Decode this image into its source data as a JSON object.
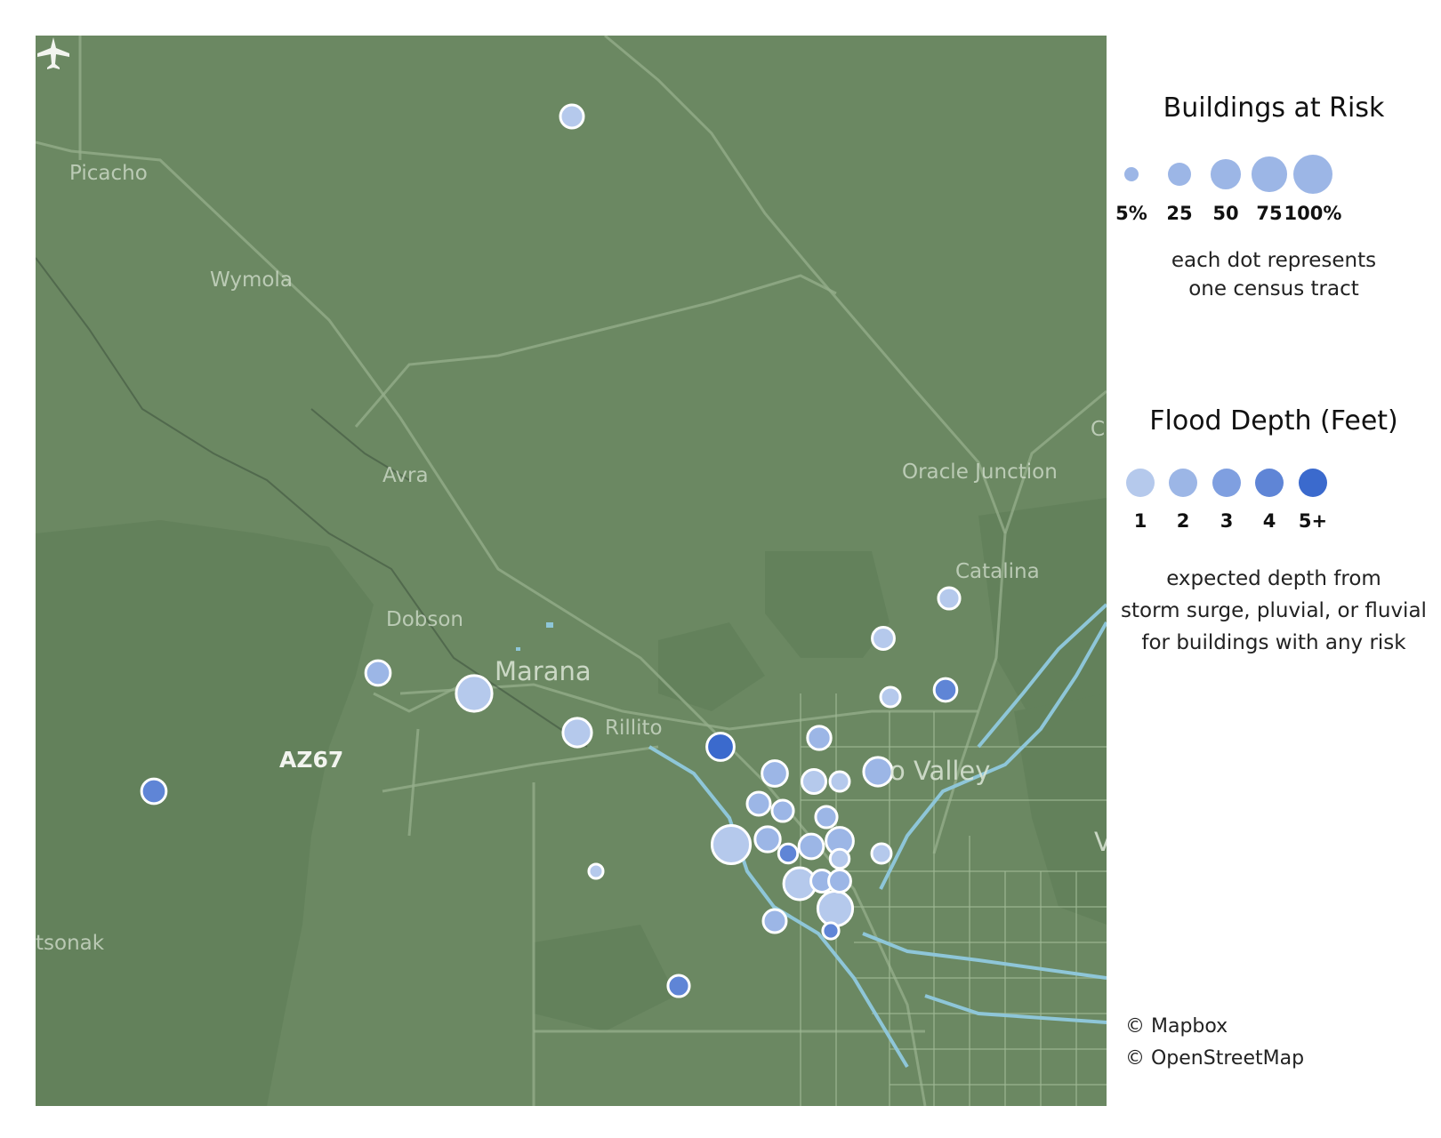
{
  "map": {
    "places": [
      {
        "name": "Picacho",
        "size": "normal"
      },
      {
        "name": "Wymola",
        "size": "normal"
      },
      {
        "name": "Avra",
        "size": "normal"
      },
      {
        "name": "Oracle Junction",
        "size": "normal"
      },
      {
        "name": "Catalina",
        "size": "normal"
      },
      {
        "name": "Dobson",
        "size": "normal"
      },
      {
        "name": "Marana",
        "size": "big"
      },
      {
        "name": "Rillito",
        "size": "normal"
      },
      {
        "name": "o Valley",
        "size": "big"
      },
      {
        "name": "tsonak",
        "size": "normal"
      },
      {
        "name": "C",
        "size": "normal"
      },
      {
        "name": "V",
        "size": "normal"
      }
    ],
    "airport": {
      "code": "AZ67",
      "icon": "airplane-icon"
    }
  },
  "legend": {
    "size_title": "Buildings at Risk",
    "size_labels": [
      "5%",
      "25",
      "50",
      "75",
      "100%"
    ],
    "size_desc_1": "each dot represents",
    "size_desc_2": "one census tract",
    "depth_title": "Flood Depth (Feet)",
    "depth_labels": [
      "1",
      "2",
      "3",
      "4",
      "5+"
    ],
    "depth_colors": [
      "#b5c9ec",
      "#9cb6e6",
      "#7f9fe0",
      "#5f85d6",
      "#3b6acd"
    ],
    "depth_desc_1": "expected depth from",
    "depth_desc_2": "storm surge, pluvial, or fluvial",
    "depth_desc_3": "for buildings with any risk"
  },
  "attribution": {
    "mapbox": "© Mapbox",
    "osm": "© OpenStreetMap"
  },
  "colors": {
    "land": "#6b8862",
    "water": "#8ec6d8",
    "dot_stroke": "#ffffff"
  },
  "tracts": [
    {
      "name": "tract-1",
      "pct": 25,
      "depth": 1
    },
    {
      "name": "tract-2",
      "pct": 30,
      "depth": 2
    },
    {
      "name": "tract-3",
      "pct": 80,
      "depth": 1
    },
    {
      "name": "tract-4",
      "pct": 45,
      "depth": 1
    },
    {
      "name": "tract-5",
      "pct": 40,
      "depth": 5
    },
    {
      "name": "tract-6",
      "pct": 30,
      "depth": 4
    },
    {
      "name": "tract-7",
      "pct": 5,
      "depth": 1
    },
    {
      "name": "tract-8",
      "pct": 20,
      "depth": 4
    },
    {
      "name": "tract-9",
      "pct": 22,
      "depth": 1
    },
    {
      "name": "tract-10",
      "pct": 20,
      "depth": 1
    },
    {
      "name": "tract-11",
      "pct": 15,
      "depth": 1
    },
    {
      "name": "tract-12",
      "pct": 24,
      "depth": 4
    },
    {
      "name": "tract-13",
      "pct": 45,
      "depth": 2
    },
    {
      "name": "tract-14",
      "pct": 26,
      "depth": 2
    },
    {
      "name": "tract-15",
      "pct": 33,
      "depth": 2
    },
    {
      "name": "tract-16",
      "pct": 28,
      "depth": 1
    },
    {
      "name": "tract-17",
      "pct": 15,
      "depth": 1
    },
    {
      "name": "tract-18",
      "pct": 25,
      "depth": 2
    },
    {
      "name": "tract-19",
      "pct": 20,
      "depth": 2
    },
    {
      "name": "tract-20",
      "pct": 20,
      "depth": 2
    },
    {
      "name": "tract-21",
      "pct": 95,
      "depth": 1
    },
    {
      "name": "tract-22",
      "pct": 32,
      "depth": 2
    },
    {
      "name": "tract-23",
      "pct": 14,
      "depth": 4
    },
    {
      "name": "tract-24",
      "pct": 30,
      "depth": 2
    },
    {
      "name": "tract-25",
      "pct": 40,
      "depth": 2
    },
    {
      "name": "tract-26",
      "pct": 14,
      "depth": 1
    },
    {
      "name": "tract-27",
      "pct": 15,
      "depth": 1
    },
    {
      "name": "tract-28",
      "pct": 60,
      "depth": 1
    },
    {
      "name": "tract-29",
      "pct": 22,
      "depth": 2
    },
    {
      "name": "tract-30",
      "pct": 75,
      "depth": 1
    },
    {
      "name": "tract-31",
      "pct": 22,
      "depth": 2
    },
    {
      "name": "tract-32",
      "pct": 25,
      "depth": 2
    },
    {
      "name": "tract-33",
      "pct": 8,
      "depth": 4
    }
  ]
}
